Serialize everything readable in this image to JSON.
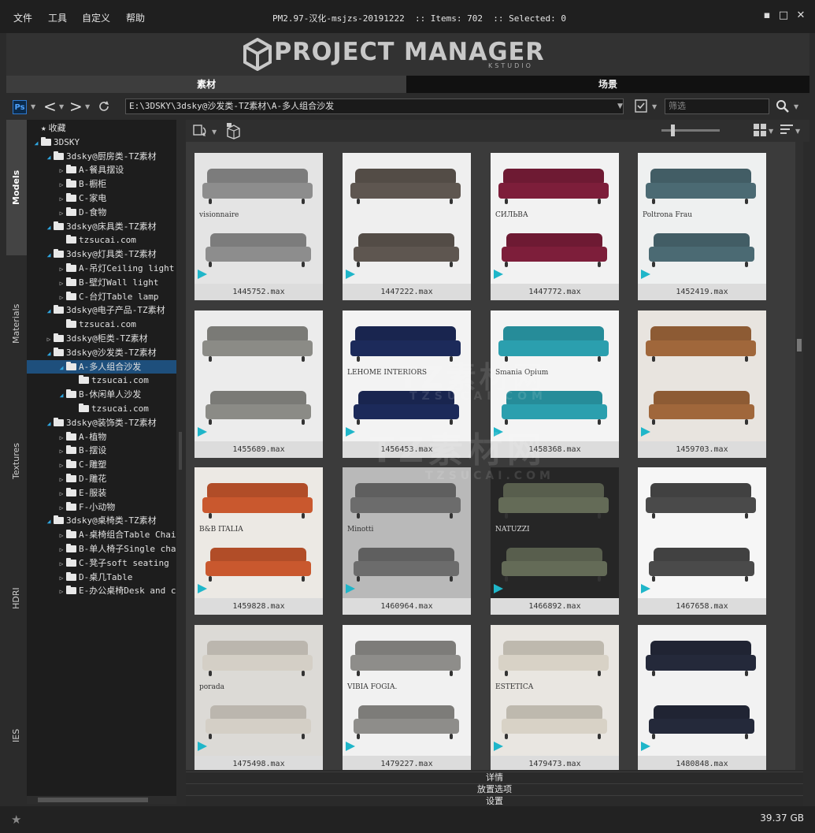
{
  "menu": [
    "文件",
    "工具",
    "自定义",
    "帮助"
  ],
  "title": "PM2.97-汉化-msjzs-20191222  :: Items: 702  :: Selected: 0",
  "window_buttons": {
    "minimize": "▪",
    "maximize": "□",
    "close": "✕"
  },
  "logo": {
    "title": "PROJECT MANAGER",
    "subtitle": "KSTUDIO"
  },
  "tabs": [
    "素材",
    "场景"
  ],
  "toolbar": {
    "ps_label": "Ps",
    "path": "E:\\3DSKY\\3dsky@沙发类-TZ素材\\A-多人组合沙发",
    "filter_placeholder": "筛选"
  },
  "vtabs": [
    "Models",
    "Materials",
    "Textures",
    "HDRI",
    "IES"
  ],
  "tree": [
    {
      "label": "收藏",
      "depth": 0,
      "arrow": "none",
      "star": true
    },
    {
      "label": "3DSKY",
      "depth": 0,
      "arrow": "open"
    },
    {
      "label": "3dsky@厨房类-TZ素材",
      "depth": 1,
      "arrow": "open"
    },
    {
      "label": "A-餐具摆设",
      "depth": 2,
      "arrow": "closed"
    },
    {
      "label": "B-橱柜",
      "depth": 2,
      "arrow": "closed"
    },
    {
      "label": "C-家电",
      "depth": 2,
      "arrow": "closed"
    },
    {
      "label": "D-食物",
      "depth": 2,
      "arrow": "closed"
    },
    {
      "label": "3dsky@床具类-TZ素材",
      "depth": 1,
      "arrow": "open"
    },
    {
      "label": "tzsucai.com",
      "depth": 2,
      "arrow": "none"
    },
    {
      "label": "3dsky@灯具类-TZ素材",
      "depth": 1,
      "arrow": "open"
    },
    {
      "label": "A-吊灯Ceiling light",
      "depth": 2,
      "arrow": "closed"
    },
    {
      "label": "B-壁灯Wall light",
      "depth": 2,
      "arrow": "closed"
    },
    {
      "label": "C-台灯Table lamp",
      "depth": 2,
      "arrow": "closed"
    },
    {
      "label": "3dsky@电子产品-TZ素材",
      "depth": 1,
      "arrow": "open"
    },
    {
      "label": "tzsucai.com",
      "depth": 2,
      "arrow": "none"
    },
    {
      "label": "3dsky@柜类-TZ素材",
      "depth": 1,
      "arrow": "closed"
    },
    {
      "label": "3dsky@沙发类-TZ素材",
      "depth": 1,
      "arrow": "open"
    },
    {
      "label": "A-多人组合沙发",
      "depth": 2,
      "arrow": "open",
      "selected": true
    },
    {
      "label": "tzsucai.com",
      "depth": 3,
      "arrow": "none"
    },
    {
      "label": "B-休闲单人沙发",
      "depth": 2,
      "arrow": "open"
    },
    {
      "label": "tzsucai.com",
      "depth": 3,
      "arrow": "none"
    },
    {
      "label": "3dsky@装饰类-TZ素材",
      "depth": 1,
      "arrow": "open"
    },
    {
      "label": "A-植物",
      "depth": 2,
      "arrow": "closed"
    },
    {
      "label": "B-摆设",
      "depth": 2,
      "arrow": "closed"
    },
    {
      "label": "C-雕塑",
      "depth": 2,
      "arrow": "closed"
    },
    {
      "label": "D-雕花",
      "depth": 2,
      "arrow": "closed"
    },
    {
      "label": "E-服装",
      "depth": 2,
      "arrow": "closed"
    },
    {
      "label": "F-小动物",
      "depth": 2,
      "arrow": "closed"
    },
    {
      "label": "3dsky@桌椅类-TZ素材",
      "depth": 1,
      "arrow": "open"
    },
    {
      "label": "A-桌椅组合Table Chair",
      "depth": 2,
      "arrow": "closed"
    },
    {
      "label": "B-单人椅子Single chair",
      "depth": 2,
      "arrow": "closed"
    },
    {
      "label": "C-凳子soft seating",
      "depth": 2,
      "arrow": "closed"
    },
    {
      "label": "D-桌几Table",
      "depth": 2,
      "arrow": "closed"
    },
    {
      "label": "E-办公桌椅Desk and ch",
      "depth": 2,
      "arrow": "closed"
    }
  ],
  "items": [
    {
      "file": "1445752.max",
      "bg": "#e4e4e4",
      "sofa": "#8d8d8d",
      "brand": "visionnaire"
    },
    {
      "file": "1447222.max",
      "bg": "#efefef",
      "sofa": "#5e5650",
      "brand": ""
    },
    {
      "file": "1447772.max",
      "bg": "#f2f2f2",
      "sofa": "#7d1e3a",
      "brand": "СИЛЬВА"
    },
    {
      "file": "1452419.max",
      "bg": "#eef0f0",
      "sofa": "#4b6a73",
      "brand": "Poltrona Frau"
    },
    {
      "file": "1455689.max",
      "bg": "#ececec",
      "sofa": "#8b8b86",
      "brand": ""
    },
    {
      "file": "1456453.max",
      "bg": "#f3f3f3",
      "sofa": "#1c2a5a",
      "brand": "LEHOME INTERIORS"
    },
    {
      "file": "1458368.max",
      "bg": "#f4f4f4",
      "sofa": "#2b9fae",
      "brand": "Smania Opium"
    },
    {
      "file": "1459703.max",
      "bg": "#e8e4df",
      "sofa": "#a0673b",
      "brand": ""
    },
    {
      "file": "1459828.max",
      "bg": "#ece9e4",
      "sofa": "#c9582e",
      "brand": "B&B ITALIA"
    },
    {
      "file": "1460964.max",
      "bg": "#b9b9b9",
      "sofa": "#6c6c6c",
      "brand": "Minotti"
    },
    {
      "file": "1466892.max",
      "bg": "#262626",
      "sofa": "#646b57",
      "brand": "NATUZZI"
    },
    {
      "file": "1467658.max",
      "bg": "#f6f6f6",
      "sofa": "#4a4a4a",
      "brand": ""
    },
    {
      "file": "1475498.max",
      "bg": "#dcdad6",
      "sofa": "#d4cfc6",
      "brand": "porada"
    },
    {
      "file": "1479227.max",
      "bg": "#f1f1f1",
      "sofa": "#8e8d8a",
      "brand": "VIBIA FOGIA."
    },
    {
      "file": "1479473.max",
      "bg": "#e9e6e1",
      "sofa": "#d8d2c6",
      "brand": "ESTETICA"
    },
    {
      "file": "1480848.max",
      "bg": "#f2f2f2",
      "sofa": "#24293a",
      "brand": ""
    }
  ],
  "watermark": {
    "main": "TZ素材网",
    "sub": "TZSUCAI.COM"
  },
  "collapsibles": [
    "详情",
    "放置选项",
    "设置"
  ],
  "status": {
    "disk_free": "39.37 GB"
  }
}
